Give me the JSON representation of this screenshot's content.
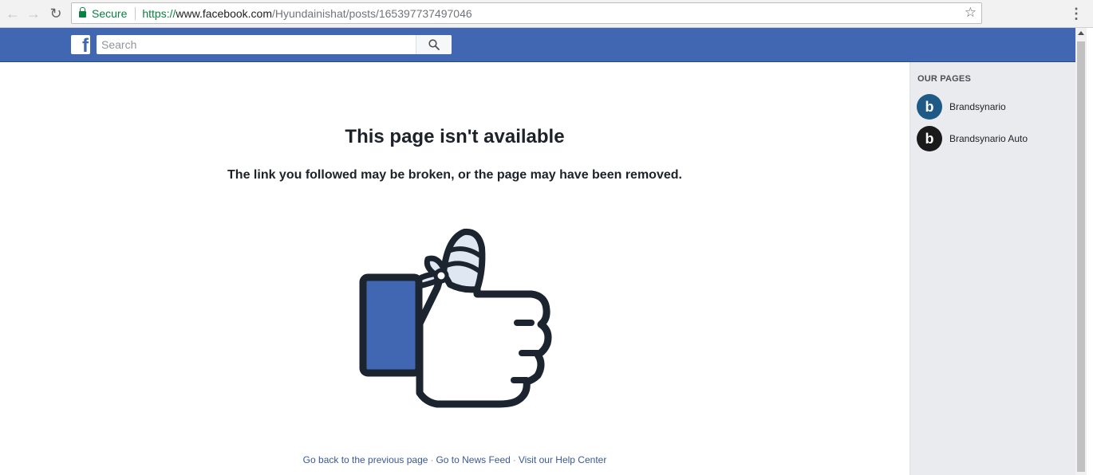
{
  "browser": {
    "back_label": "←",
    "forward_label": "→",
    "reload_label": "↻",
    "secure_text": "Secure",
    "url_scheme": "https://",
    "url_host": "www.facebook.com",
    "url_path": "/Hyundainishat/posts/165397737497046",
    "star_icon": "☆",
    "menu_icon": "⋮"
  },
  "fbbar": {
    "logo_letter": "f",
    "search_placeholder": "Search"
  },
  "main": {
    "title": "This page isn't available",
    "subtitle": "The link you followed may be broken, or the page may have been removed.",
    "links": {
      "back": "Go back to the previous page",
      "news_feed": "Go to News Feed",
      "help": "Visit our Help Center",
      "separator": "·"
    }
  },
  "sidebar": {
    "heading": "OUR PAGES",
    "pages": [
      {
        "name": "Brandsynario",
        "avatar_letter": "b",
        "avatar_color": "#1e5a85"
      },
      {
        "name": "Brandsynario Auto",
        "avatar_letter": "b",
        "avatar_color": "#1a1a1a"
      }
    ]
  },
  "colors": {
    "fb_blue": "#4267b2",
    "link": "#385898",
    "secure_green": "#0b8043"
  }
}
